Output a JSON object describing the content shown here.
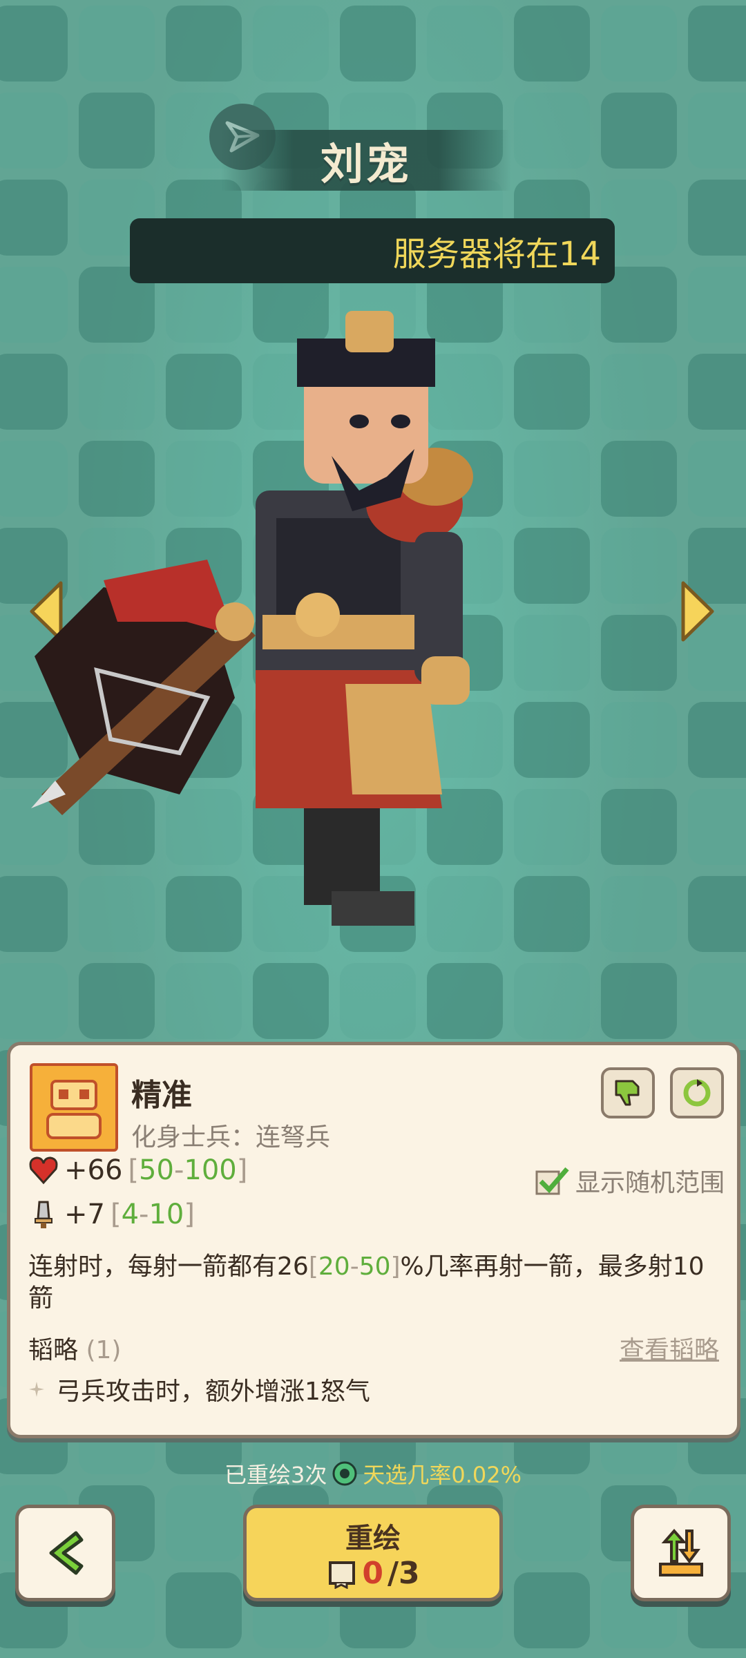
{
  "hero": {
    "name": "刘宠"
  },
  "notice": {
    "text": "服务器将在14"
  },
  "skill": {
    "name": "精准",
    "subtitle_label": "化身士兵：",
    "subtitle_value": "连弩兵"
  },
  "stats": {
    "hp": {
      "value": "+66",
      "range_open": "[",
      "min": "50",
      "sep": "-",
      "max": "100",
      "range_close": "]"
    },
    "atk": {
      "value": "+7",
      "range_open": "[",
      "min": "4",
      "sep": "-",
      "max": "10",
      "range_close": "]"
    }
  },
  "toggle": {
    "label": "显示随机范围",
    "checked": true
  },
  "description": {
    "pre": "连射时，每射一箭都有",
    "value": "26",
    "range_open": "[",
    "min": "20",
    "sep": "-",
    "max": "50",
    "range_close": "]",
    "post": "%几率再射一箭，最多射10箭"
  },
  "tactics": {
    "label": "韬略",
    "count": "(1)",
    "link": "查看韬略",
    "items": [
      "弓兵攻击时，额外增涨1怒气"
    ]
  },
  "redraw_info": {
    "count_text": "已重绘3次",
    "chance_text": "天选几率0.02%"
  },
  "buttons": {
    "redraw_label": "重绘",
    "redraw_current": "0",
    "redraw_total": "/3"
  },
  "colors": {
    "accent_yellow": "#f6d45a",
    "range_green": "#5fae3c",
    "card_bg": "#fbf3e4"
  }
}
